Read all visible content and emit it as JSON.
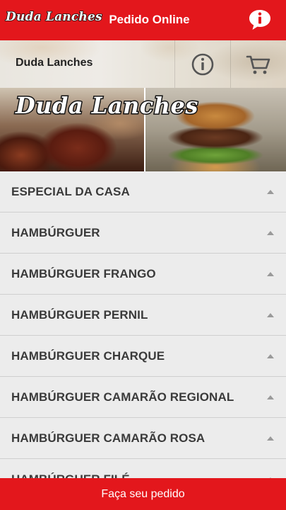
{
  "header": {
    "logo_text": "Duda Lanches",
    "title": "Pedido Online",
    "chat_icon": "info-chat-icon"
  },
  "store": {
    "name": "Duda Lanches",
    "info_icon": "info-icon",
    "cart_icon": "cart-icon"
  },
  "banner": {
    "logo_text": "Duda Lanches"
  },
  "categories": [
    {
      "label": "ESPECIAL DA CASA"
    },
    {
      "label": "HAMBÚRGUER"
    },
    {
      "label": "HAMBÚRGUER FRANGO"
    },
    {
      "label": "HAMBÚRGUER PERNIL"
    },
    {
      "label": "HAMBÚRGUER CHARQUE"
    },
    {
      "label": "HAMBÚRGUER CAMARÃO REGIONAL"
    },
    {
      "label": "HAMBÚRGUER CAMARÃO ROSA"
    },
    {
      "label": "HAMBÚRGUER FILÉ"
    }
  ],
  "footer": {
    "order_label": "Faça seu pedido"
  },
  "colors": {
    "brand_red": "#e3171c",
    "list_bg": "#ececec",
    "text_dark": "#3a3a3a"
  }
}
